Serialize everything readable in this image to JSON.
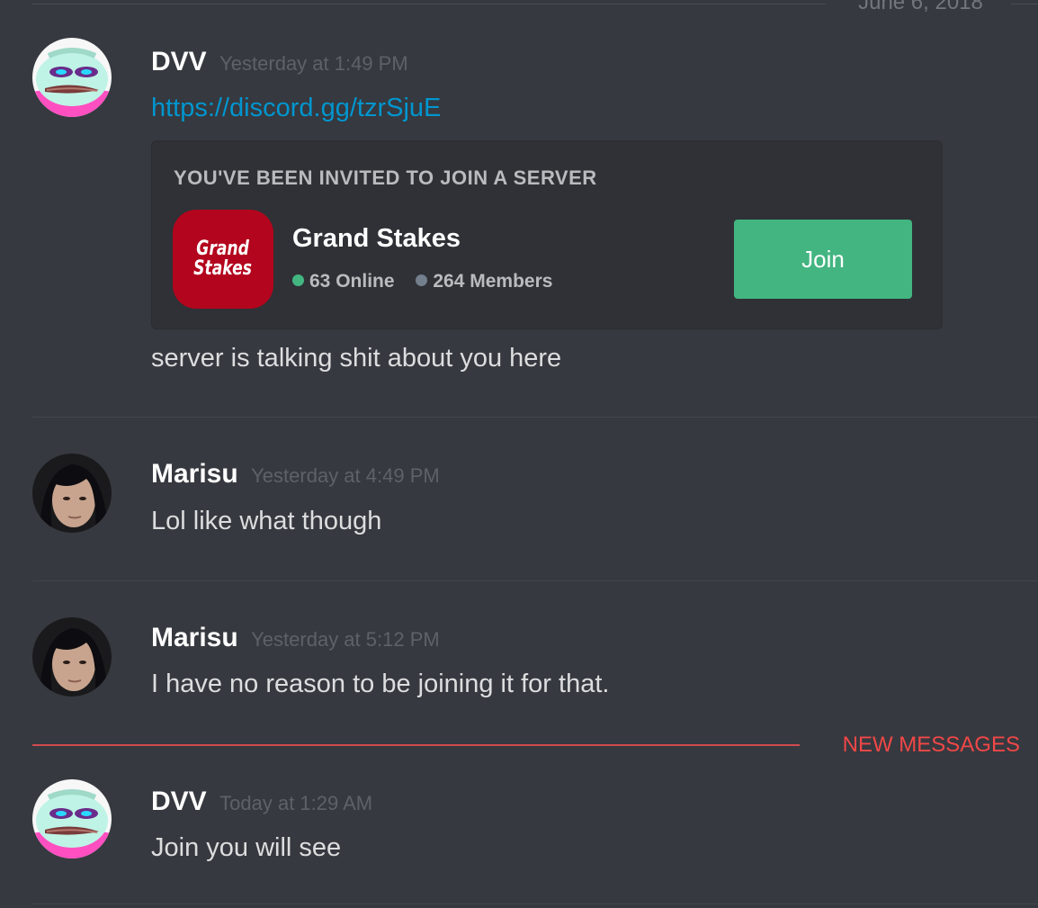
{
  "date_divider": "June 6, 2018",
  "messages": [
    {
      "username": "DVV",
      "timestamp": "Yesterday at 1:49 PM",
      "link": "https://discord.gg/tzrSjuE",
      "text": "server is talking shit about you here",
      "avatar": "pepe-avatar"
    },
    {
      "username": "Marisu",
      "timestamp": "Yesterday at 4:49 PM",
      "text": "Lol like what though",
      "avatar": "photo-avatar"
    },
    {
      "username": "Marisu",
      "timestamp": "Yesterday at 5:12 PM",
      "text": "I have no reason to be joining it for that.",
      "avatar": "photo-avatar"
    },
    {
      "username": "DVV",
      "timestamp": "Today at 1:29 AM",
      "text": "Join you will see",
      "avatar": "pepe-avatar"
    }
  ],
  "invite": {
    "title": "YOU'VE BEEN INVITED TO JOIN A SERVER",
    "icon_line1": "Grand",
    "icon_line2": "Stakes",
    "icon_color": "#b3051d",
    "server_name": "Grand Stakes",
    "online": "63 Online",
    "members": "264 Members",
    "join_label": "Join",
    "join_color": "#43b581"
  },
  "new_messages_label": "NEW MESSAGES"
}
